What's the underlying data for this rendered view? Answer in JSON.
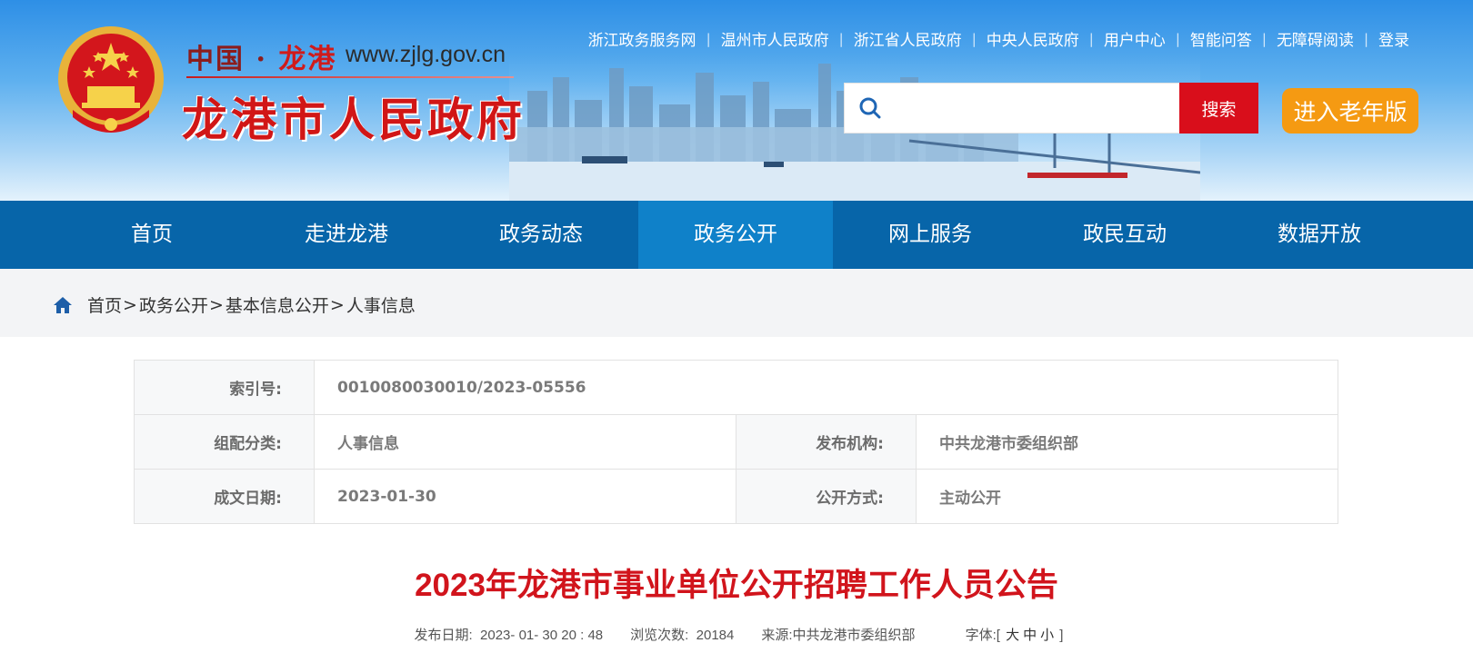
{
  "header": {
    "site_prefix": "中国 · ",
    "site_city": "龙港",
    "site_url": "www.zjlg.gov.cn",
    "site_name": "龙港市人民政府",
    "top_links": [
      "浙江政务服务网",
      "温州市人民政府",
      "浙江省人民政府",
      "中央人民政府",
      "用户中心",
      "智能问答",
      "无障碍阅读",
      "登录"
    ],
    "search": {
      "placeholder": "",
      "button_label": "搜索"
    },
    "elder_button": "进入老年版"
  },
  "nav": {
    "items": [
      "首页",
      "走进龙港",
      "政务动态",
      "政务公开",
      "网上服务",
      "政民互动",
      "数据开放"
    ],
    "active_index": 3
  },
  "breadcrumb": [
    "首页",
    "政务公开",
    "基本信息公开",
    "人事信息"
  ],
  "info": {
    "index_label": "索引号:",
    "index_value": "0010080030010/2023-05556",
    "category_label": "组配分类:",
    "category_value": "人事信息",
    "publisher_label": "发布机构:",
    "publisher_value": "中共龙港市委组织部",
    "date_label": "成文日期:",
    "date_value": "2023-01-30",
    "disclosure_label": "公开方式:",
    "disclosure_value": "主动公开"
  },
  "article": {
    "title": "2023年龙港市事业单位公开招聘工作人员公告",
    "publish_label": "发布日期:",
    "publish_value": "2023- 01- 30 20 : 48",
    "views_label": "浏览次数:",
    "views_value": "20184",
    "source_label": "来源:",
    "source_value": "中共龙港市委组织部",
    "font_label": "字体:",
    "font_open": "[",
    "font_large": "大",
    "font_medium": "中",
    "font_small": "小",
    "font_close": "]"
  },
  "colors": {
    "nav_bg": "#0765a9",
    "nav_active": "#0f81c9",
    "search_button": "#d90e1b",
    "elder_button": "#f59a12",
    "title": "#d1141c"
  }
}
